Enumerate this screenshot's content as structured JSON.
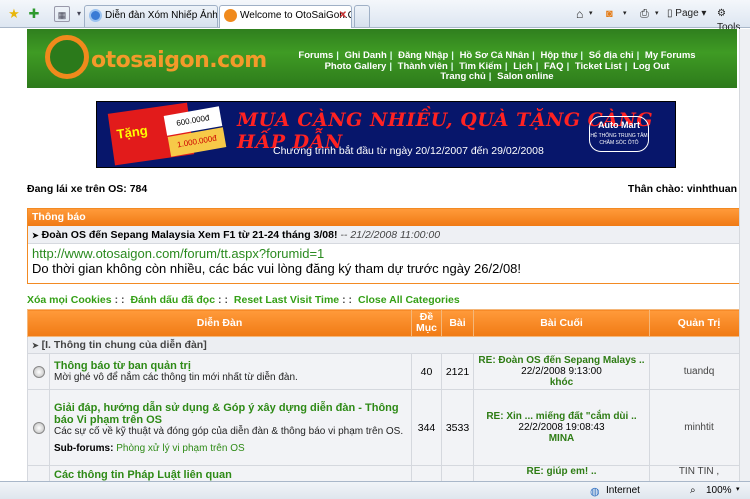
{
  "browser": {
    "tabs": [
      {
        "label": "Diễn đàn Xóm Nhiếp Ảnh",
        "active": false
      },
      {
        "label": "Welcome to OtoSaiGon.C...",
        "active": true
      }
    ],
    "toolbar": {
      "page_label": "Page",
      "tools_label": "Tools"
    },
    "status": {
      "zone": "Internet",
      "zoom": "100%"
    }
  },
  "site": {
    "logo_text": "otosaigon.com",
    "nav": [
      [
        "Forums",
        "Ghi Danh",
        "Đăng Nhập",
        "Hồ Sơ Cá Nhân",
        "Hộp thư",
        "Sổ địa chỉ",
        "My Forums"
      ],
      [
        "Photo Gallery",
        "Thành viên",
        "Tìm Kiếm",
        "Lịch",
        "FAQ",
        "Ticket List",
        "Log Out"
      ],
      [
        "Trang chủ",
        "Salon online"
      ]
    ]
  },
  "banner": {
    "tag_text": "Tặng",
    "card1": "600.000đ",
    "card2": "1.000.000đ",
    "headline": "MUA CÀNG NHIỀU, QUÀ TẶNG CÀNG HẤP DẪN",
    "sub": "Chương trình bắt đầu từ ngày 20/12/2007 đến 29/02/2008",
    "brand": "Auto Mart",
    "brand_sub": "HỆ THỐNG TRUNG TÂM CHĂM SÓC ÔTÔ"
  },
  "online": {
    "left": "Đang lái xe trên OS: 784",
    "right": "Thân chào: vinhthuan"
  },
  "notice": {
    "header": "Thông báo",
    "title": "Đoàn OS đến Sepang Malaysia Xem F1 từ 21-24 tháng 3/08!",
    "date": "-- 21/2/2008 11:00:00",
    "link": "http://www.otosaigon.com/forum/tt.aspx?forumid=1",
    "message": "Do thời gian không còn nhiều, các bác vui lòng đăng ký tham dự trước ngày 26/2/08!"
  },
  "actions": [
    "Xóa mọi Cookies",
    "Đánh dấu đã đọc",
    "Reset Last Visit Time",
    "Close All Categories"
  ],
  "table": {
    "headers": {
      "forum": "Diễn Đàn",
      "topics_1": "Đề",
      "topics_2": "Mục",
      "posts": "Bài",
      "last": "Bài Cuối",
      "mod": "Quản Trị"
    },
    "category": "[I. Thông tin chung của diễn đàn]",
    "rows": [
      {
        "name": "Thông báo từ ban quản trị",
        "desc": "Mời ghé vô để nắm các thông tin mới nhất từ diễn đàn.",
        "topics": "40",
        "posts": "2121",
        "last_title": "RE: Đoàn OS đến Sepang Malays ..",
        "last_date": "22/2/2008 9:13:00",
        "last_user": "khóc",
        "mod": "tuandq"
      },
      {
        "name": "Giải đáp, hướng dẫn sử dụng & Góp ý xây dựng diễn đàn - Thông báo Vi phạm trên OS",
        "desc": "Các sự cố về kỹ thuật và đóng góp của diễn đàn & thông báo vi phạm trên OS.",
        "topics": "344",
        "posts": "3533",
        "last_title": "RE: Xin ... miếng đất \"cắm dùi ..",
        "last_date": "22/2/2008 19:08:43",
        "last_user": "MINA",
        "mod": "minhtit",
        "subforums_label": "Sub-forums:",
        "subforums": "Phòng xử lý vi phạm trên OS"
      },
      {
        "name": "Các thông tin Pháp Luật liên quan",
        "last_title": "RE: giúp em! ..",
        "mod": "TIN TIN ,"
      }
    ]
  }
}
